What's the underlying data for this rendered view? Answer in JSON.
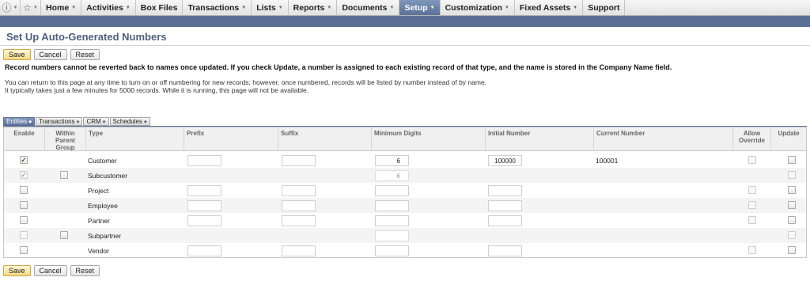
{
  "nav": {
    "items": [
      "Home",
      "Activities",
      "Box Files",
      "Transactions",
      "Lists",
      "Reports",
      "Documents",
      "Setup",
      "Customization",
      "Fixed Assets",
      "Support"
    ],
    "active": "Setup"
  },
  "page": {
    "title": "Set Up Auto-Generated Numbers",
    "warning": "Record numbers cannot be reverted back to names once updated. If you check Update, a number is assigned to each existing record of that type, and the name is stored in the Company Name field.",
    "info_line1": "You can return to this page at any time to turn on or off numbering for new records; however, once numbered, records will be listed by number instead of by name.",
    "info_line2": "It typically takes just a few minutes for 5000 records. While it is running, this page will not be available."
  },
  "buttons": {
    "save": "Save",
    "cancel": "Cancel",
    "reset": "Reset"
  },
  "subtabs": [
    "Entities",
    "Transactions",
    "CRM",
    "Schedules"
  ],
  "table": {
    "headers": {
      "enable": "Enable",
      "within": "Within Parent Group",
      "type": "Type",
      "prefix": "Prefix",
      "suffix": "Suffix",
      "min_digits": "Minimum Digits",
      "initial": "Initial Number",
      "current": "Current Number",
      "override": "Allow Override",
      "update": "Update"
    },
    "rows": [
      {
        "type": "Customer",
        "min_digits": "6",
        "initial": "100000",
        "current": "100001"
      },
      {
        "type": "Subcustomer",
        "min_digits": "6",
        "initial": "",
        "current": ""
      },
      {
        "type": "Project",
        "min_digits": "",
        "initial": "",
        "current": ""
      },
      {
        "type": "Employee",
        "min_digits": "",
        "initial": "",
        "current": ""
      },
      {
        "type": "Partner",
        "min_digits": "",
        "initial": "",
        "current": ""
      },
      {
        "type": "Subpartner",
        "min_digits": "",
        "initial": "",
        "current": ""
      },
      {
        "type": "Vendor",
        "min_digits": "",
        "initial": "",
        "current": ""
      }
    ]
  },
  "icons": {
    "help": "help-circle-icon",
    "favorites": "star-icon",
    "dropdown": "chevron-down-icon",
    "check": "checkmark-icon"
  },
  "colors": {
    "accent": "#5b6f95",
    "title": "#4d5f7c",
    "primary_button": "#f3d982"
  }
}
